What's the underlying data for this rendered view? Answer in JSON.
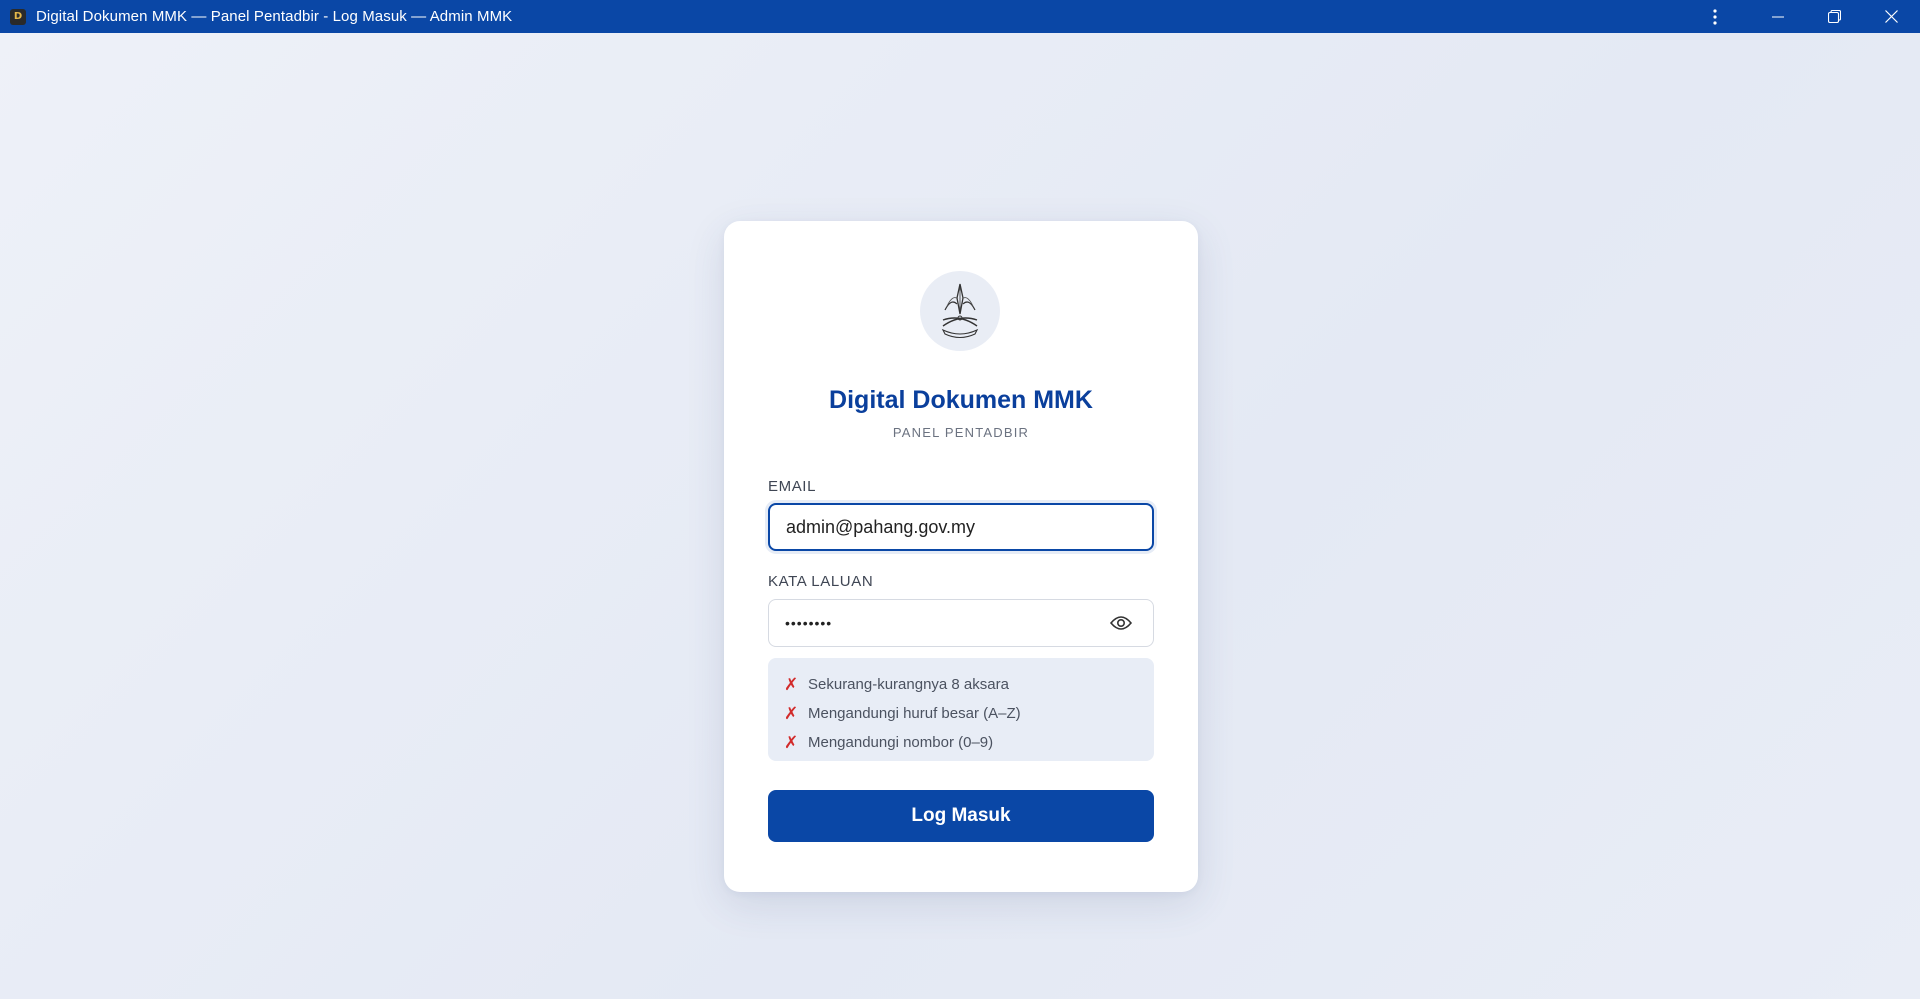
{
  "window": {
    "app_icon_letter": "D",
    "title": "Digital Dokumen MMK — Panel Pentadbir - Log Masuk — Admin MMK",
    "controls": [
      "menu-icon",
      "minimize-icon",
      "restore-icon",
      "close-icon"
    ]
  },
  "card": {
    "logo_icon": "state-crest-icon",
    "title": "Digital Dokumen MMK",
    "subtitle": "PANEL PENTADBIR"
  },
  "form": {
    "email_label": "EMAIL",
    "email_value": "admin@pahang.gov.my",
    "password_label": "KATA LALUAN",
    "password_value": "••••••••",
    "password_toggle_icon": "eye-icon",
    "rules": [
      {
        "mark": "✗",
        "text": "Sekurang-kurangnya 8 aksara"
      },
      {
        "mark": "✗",
        "text": "Mengandungi huruf besar (A–Z)"
      },
      {
        "mark": "✗",
        "text": "Mengandungi nombor (0–9)"
      }
    ],
    "submit_label": "Log Masuk"
  },
  "colors": {
    "brand": "#0a47a6",
    "title": "#0a3f9c",
    "rule_fail": "#d22b2b",
    "background": "#e9edf6"
  }
}
